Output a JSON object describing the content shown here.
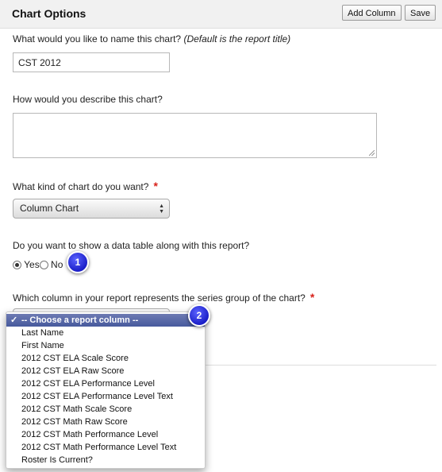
{
  "header": {
    "title": "Chart Options",
    "add_column_label": "Add Column",
    "save_label": "Save"
  },
  "name_field": {
    "label": "What would you like to name this chart?",
    "hint": "(Default is the report title)",
    "value": "CST 2012"
  },
  "description_field": {
    "label": "How would you describe this chart?",
    "value": ""
  },
  "chart_type": {
    "label": "What kind of chart do you want?",
    "required_mark": "*",
    "selected": "Column Chart"
  },
  "data_table": {
    "label": "Do you want to show a data table along with this report?",
    "yes_label": "Yes",
    "no_label": "No",
    "selected": "Yes"
  },
  "series_column": {
    "label": "Which column in your report represents the series group of the chart?",
    "required_mark": "*",
    "options": [
      "-- Choose a report column --",
      "Last Name",
      "First Name",
      "2012 CST ELA Scale Score",
      "2012 CST ELA Raw Score",
      "2012 CST ELA Performance Level",
      "2012 CST ELA Performance Level Text",
      "2012 CST Math Scale Score",
      "2012 CST Math Raw Score",
      "2012 CST Math Performance Level",
      "2012 CST Math Performance Level Text",
      "Roster Is Current?"
    ],
    "selected_index": 0,
    "check_glyph": "✓"
  },
  "callouts": {
    "one": "1",
    "two": "2"
  }
}
